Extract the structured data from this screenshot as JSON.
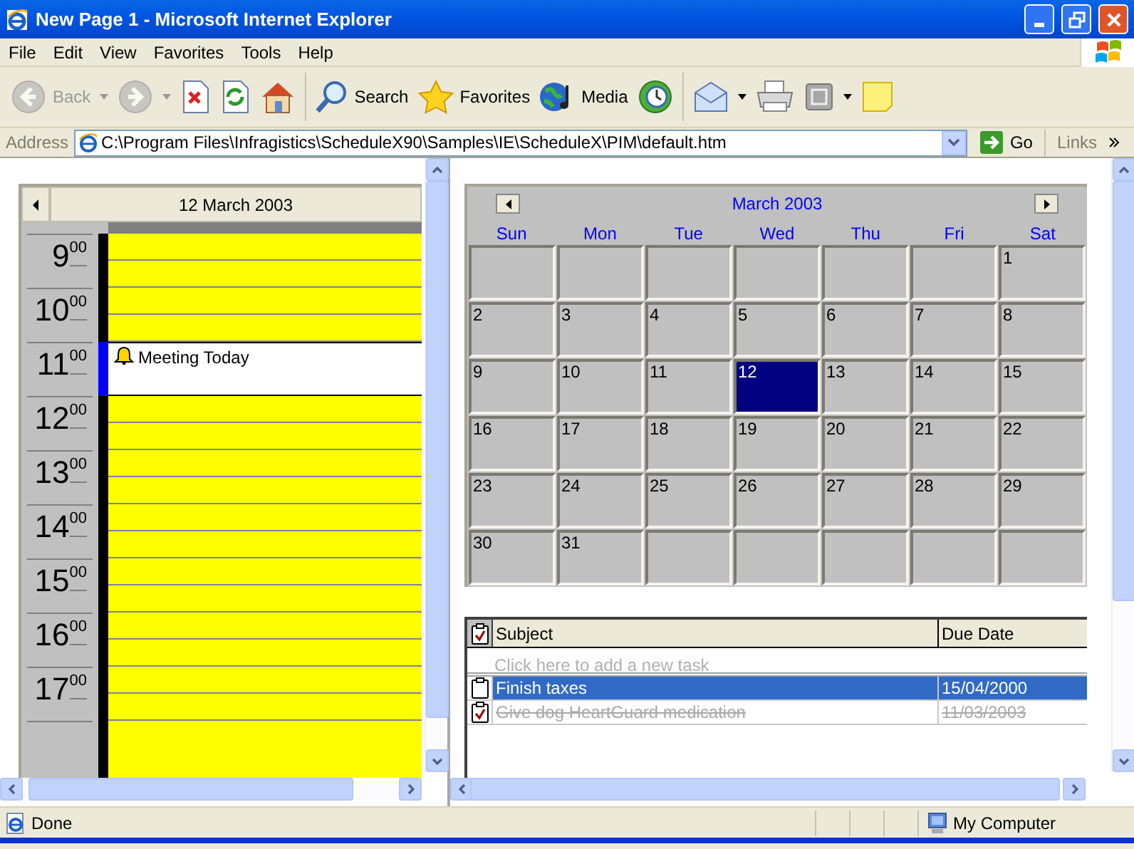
{
  "window": {
    "title": "New Page 1 - Microsoft Internet Explorer"
  },
  "menu": [
    "File",
    "Edit",
    "View",
    "Favorites",
    "Tools",
    "Help"
  ],
  "toolbar": [
    {
      "kind": "button",
      "label": "Back",
      "disabled": true,
      "dropdown": true
    },
    {
      "kind": "button",
      "disabled": true,
      "dropdown": true
    },
    {
      "kind": "button",
      "disabled": false,
      "dropdown": false
    },
    {
      "kind": "button",
      "disabled": false,
      "dropdown": false
    },
    {
      "kind": "button",
      "disabled": false,
      "dropdown": false
    },
    {
      "kind": "separator"
    },
    {
      "kind": "button",
      "label": "Search",
      "disabled": false,
      "dropdown": false
    },
    {
      "kind": "button",
      "label": "Favorites",
      "disabled": false,
      "dropdown": false
    },
    {
      "kind": "button",
      "label": "Media",
      "disabled": false,
      "dropdown": false
    },
    {
      "kind": "button",
      "disabled": false,
      "dropdown": false
    },
    {
      "kind": "separator"
    },
    {
      "kind": "button",
      "disabled": false,
      "dropdown": true
    },
    {
      "kind": "button",
      "disabled": false,
      "dropdown": false
    },
    {
      "kind": "button",
      "disabled": false,
      "dropdown": true
    },
    {
      "kind": "button",
      "disabled": false,
      "dropdown": false
    }
  ],
  "address": {
    "label": "Address",
    "url": "C:\\Program Files\\Infragistics\\ScheduleX90\\Samples\\IE\\ScheduleX\\PIM\\default.htm",
    "go": "Go",
    "links": "Links"
  },
  "day_view": {
    "date": "12 March 2003",
    "hours": [
      {
        "hour": "9",
        "minutes": "00"
      },
      {
        "hour": "10",
        "minutes": "00"
      },
      {
        "hour": "11",
        "minutes": "00",
        "appointment": {
          "subject": "Meeting Today",
          "reminder": true
        }
      },
      {
        "hour": "12",
        "minutes": "00"
      },
      {
        "hour": "13",
        "minutes": "00"
      },
      {
        "hour": "14",
        "minutes": "00"
      },
      {
        "hour": "15",
        "minutes": "00"
      },
      {
        "hour": "16",
        "minutes": "00"
      },
      {
        "hour": "17",
        "minutes": "00"
      }
    ]
  },
  "month_view": {
    "title": "March 2003",
    "weekdays": [
      "Sun",
      "Mon",
      "Tue",
      "Wed",
      "Thu",
      "Fri",
      "Sat"
    ],
    "days": [
      {
        "selected": false
      },
      {
        "selected": false
      },
      {
        "selected": false
      },
      {
        "selected": false
      },
      {
        "selected": false
      },
      {
        "selected": false
      },
      {
        "day": "1",
        "selected": false
      },
      {
        "day": "2",
        "selected": false
      },
      {
        "day": "3",
        "selected": false
      },
      {
        "day": "4",
        "selected": false
      },
      {
        "day": "5",
        "selected": false
      },
      {
        "day": "6",
        "selected": false
      },
      {
        "day": "7",
        "selected": false
      },
      {
        "day": "8",
        "selected": false
      },
      {
        "day": "9",
        "selected": false
      },
      {
        "day": "10",
        "selected": false
      },
      {
        "day": "11",
        "selected": false
      },
      {
        "day": "12",
        "selected": true
      },
      {
        "day": "13",
        "selected": false
      },
      {
        "day": "14",
        "selected": false
      },
      {
        "day": "15",
        "selected": false
      },
      {
        "day": "16",
        "selected": false
      },
      {
        "day": "17",
        "selected": false
      },
      {
        "day": "18",
        "selected": false
      },
      {
        "day": "19",
        "selected": false
      },
      {
        "day": "20",
        "selected": false
      },
      {
        "day": "21",
        "selected": false
      },
      {
        "day": "22",
        "selected": false
      },
      {
        "day": "23",
        "selected": false
      },
      {
        "day": "24",
        "selected": false
      },
      {
        "day": "25",
        "selected": false
      },
      {
        "day": "26",
        "selected": false
      },
      {
        "day": "27",
        "selected": false
      },
      {
        "day": "28",
        "selected": false
      },
      {
        "day": "29",
        "selected": false
      },
      {
        "day": "30",
        "selected": false
      },
      {
        "day": "31",
        "selected": false
      },
      {
        "selected": false
      },
      {
        "selected": false
      },
      {
        "selected": false
      },
      {
        "selected": false
      },
      {
        "selected": false
      }
    ]
  },
  "tasks": {
    "columns": [
      "Subject",
      "Due Date"
    ],
    "new_task": {
      "placeholder": "Click here to add a new task"
    },
    "rows": [
      {
        "subject": "Finish taxes",
        "due": "15/04/2000",
        "completed": false,
        "selected": true
      },
      {
        "subject": "Give dog HeartGuard medication",
        "due": "11/03/2003",
        "completed": true,
        "selected": false
      }
    ]
  },
  "status_bar": {
    "text": "Done",
    "zone": "My Computer"
  }
}
